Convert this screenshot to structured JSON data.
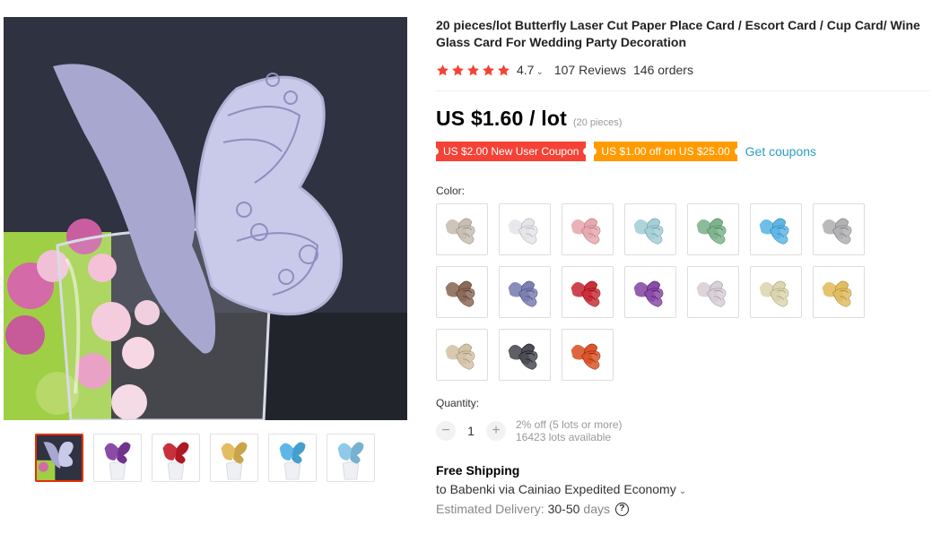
{
  "product": {
    "title": "20 pieces/lot Butterfly Laser Cut Paper Place Card / Escort Card / Cup Card/ Wine Glass Card For Wedding Party Decoration",
    "rating": "4.7",
    "reviews": "107 Reviews",
    "orders": "146 orders",
    "price": "US $1.60 / lot",
    "price_unit": "(20 pieces)"
  },
  "coupons": {
    "new_user": "US $2.00 New User Coupon",
    "store": "US $1.00 off on US $25.00",
    "get": "Get coupons"
  },
  "colors": {
    "accent_red": "#e62e04",
    "coupon_red": "#f44336",
    "coupon_orange": "#ff9b00",
    "link_blue": "#2e9cc3",
    "star": "#f44336"
  },
  "color_label": "Color:",
  "swatches": [
    {
      "name": "swatch-beige",
      "color": "#c9bfb3"
    },
    {
      "name": "swatch-white",
      "color": "#e6e6ea"
    },
    {
      "name": "swatch-pink",
      "color": "#e7aab0"
    },
    {
      "name": "swatch-light-blue",
      "color": "#a6cfd8"
    },
    {
      "name": "swatch-green",
      "color": "#7fb48e"
    },
    {
      "name": "swatch-sky-blue",
      "color": "#5fb7e6"
    },
    {
      "name": "swatch-gray",
      "color": "#b2b2b5"
    },
    {
      "name": "swatch-brown",
      "color": "#8d6b5b"
    },
    {
      "name": "swatch-lavender",
      "color": "#7d7fb3"
    },
    {
      "name": "swatch-red",
      "color": "#c8303b"
    },
    {
      "name": "swatch-purple",
      "color": "#8a4ca6"
    },
    {
      "name": "swatch-silver",
      "color": "#d9cfd7"
    },
    {
      "name": "swatch-cream",
      "color": "#dcd6b0"
    },
    {
      "name": "swatch-gold",
      "color": "#e2bd62"
    },
    {
      "name": "swatch-champagne",
      "color": "#d4c4a7"
    },
    {
      "name": "swatch-dark-gray",
      "color": "#4c4d55"
    },
    {
      "name": "swatch-orange",
      "color": "#d8562a"
    }
  ],
  "thumbnails": [
    {
      "name": "thumb-lavender",
      "color": "#b9b9de",
      "active": true
    },
    {
      "name": "thumb-purple",
      "color": "#8a4ca6"
    },
    {
      "name": "thumb-red",
      "color": "#c8303b"
    },
    {
      "name": "thumb-gold",
      "color": "#e2bd62"
    },
    {
      "name": "thumb-sky-blue",
      "color": "#5fb7e6"
    },
    {
      "name": "thumb-light-blue",
      "color": "#8fcbe8"
    }
  ],
  "quantity": {
    "label": "Quantity:",
    "value": "1",
    "minus": "−",
    "plus": "+",
    "discount": "2% off (5 lots or more)",
    "available": "16423 lots available"
  },
  "shipping": {
    "title": "Free Shipping",
    "route": "to Babenki via Cainiao Expedited Economy",
    "estimate_label": "Estimated Delivery:",
    "estimate_value": "30-50",
    "estimate_unit": "days",
    "help": "?"
  }
}
